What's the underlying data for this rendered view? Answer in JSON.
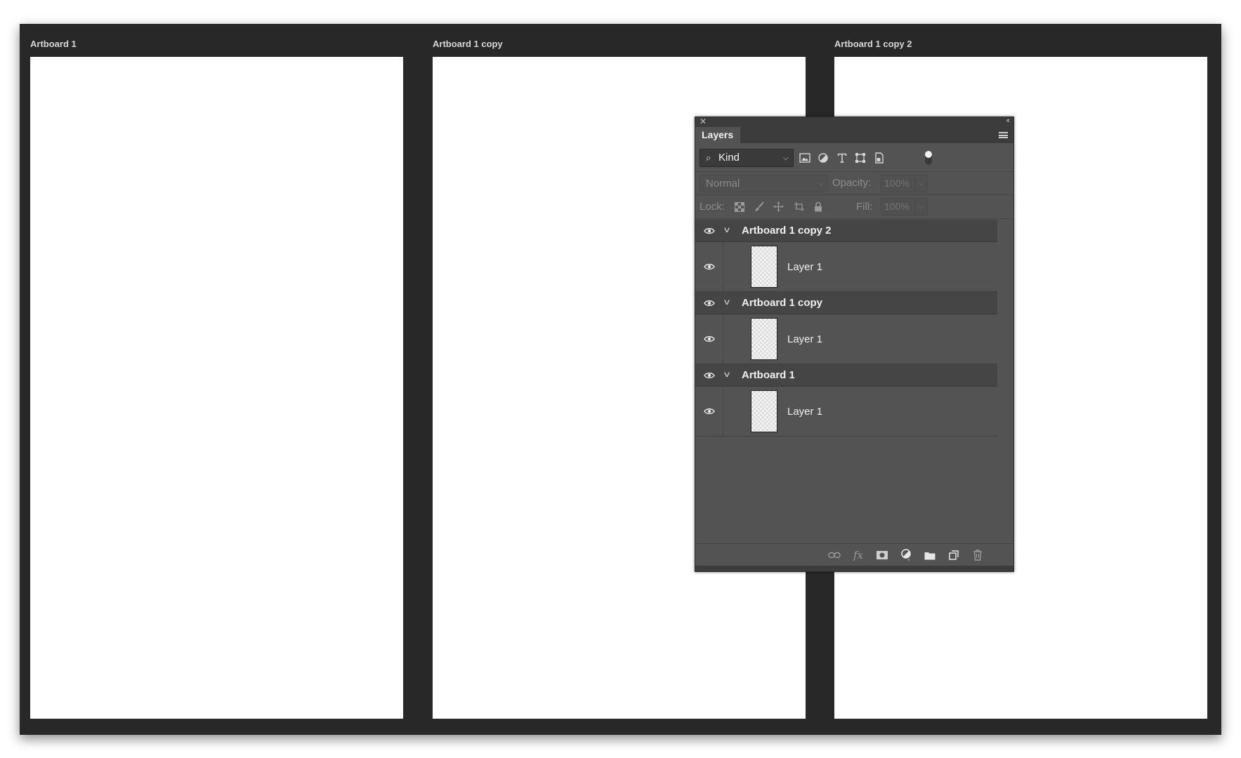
{
  "artboards": [
    {
      "label": "Artboard 1"
    },
    {
      "label": "Artboard 1 copy"
    },
    {
      "label": "Artboard 1 copy 2"
    }
  ],
  "layers_panel": {
    "tab_label": "Layers",
    "filter": {
      "kind_value": "Kind",
      "icons": [
        "image-filter-icon",
        "adjustment-filter-icon",
        "type-filter-icon",
        "shape-filter-icon",
        "smart-object-filter-icon"
      ]
    },
    "blend_mode": "Normal",
    "opacity_label": "Opacity:",
    "opacity_value": "100%",
    "lock_label": "Lock:",
    "fill_label": "Fill:",
    "fill_value": "100%",
    "groups": [
      {
        "name": "Artboard 1 copy 2",
        "layers": [
          {
            "name": "Layer 1"
          }
        ]
      },
      {
        "name": "Artboard 1 copy",
        "layers": [
          {
            "name": "Layer 1"
          }
        ]
      },
      {
        "name": "Artboard 1",
        "layers": [
          {
            "name": "Layer 1"
          }
        ]
      }
    ],
    "bottom_icons": [
      "link-icon",
      "fx-icon",
      "mask-icon",
      "adjustment-icon",
      "folder-icon",
      "new-layer-icon",
      "trash-icon"
    ],
    "fx_label": "fx"
  },
  "colors": {
    "canvas_bg": "#282828",
    "panel_bg": "#535353",
    "artboard": "#ffffff"
  }
}
